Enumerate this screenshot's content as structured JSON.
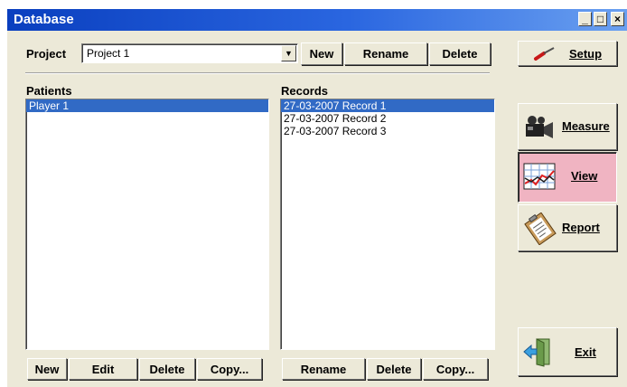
{
  "window": {
    "title": "Database"
  },
  "title_buttons": {
    "minimize": "_",
    "maximize": "□",
    "close": "×"
  },
  "project": {
    "label": "Project",
    "selected": "Project 1",
    "buttons": {
      "new": "New",
      "rename": "Rename",
      "delete": "Delete"
    }
  },
  "patients": {
    "header": "Patients",
    "items": [
      {
        "label": "Player 1",
        "selected": true
      }
    ],
    "buttons": {
      "new": "New",
      "edit": "Edit",
      "delete": "Delete",
      "copy": "Copy..."
    }
  },
  "records": {
    "header": "Records",
    "items": [
      {
        "label": "27-03-2007 Record 1",
        "selected": true
      },
      {
        "label": "27-03-2007 Record 2",
        "selected": false
      },
      {
        "label": "27-03-2007 Record 3",
        "selected": false
      }
    ],
    "buttons": {
      "rename": "Rename",
      "delete": "Delete",
      "copy": "Copy..."
    }
  },
  "side": {
    "setup": "Setup",
    "measure": "Measure",
    "view": "View",
    "report": "Report",
    "exit": "Exit"
  },
  "colors": {
    "selection": "#316ac5",
    "active_button": "#f0b4c2",
    "titlebar": "#0a3fbf"
  },
  "icons": {
    "setup": "screwdriver-icon",
    "measure": "video-camera-icon",
    "view": "line-graph-icon",
    "report": "clipboard-report-icon",
    "exit": "exit-door-icon"
  }
}
